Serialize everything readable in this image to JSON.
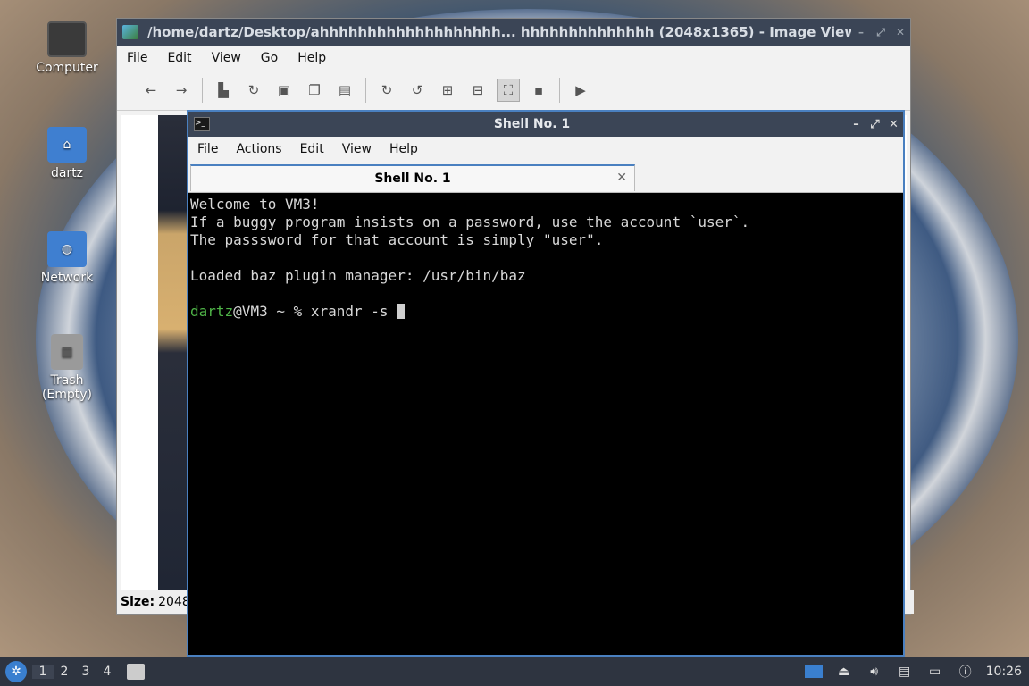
{
  "desktop": {
    "icons": [
      {
        "label": "Computer",
        "icon": "computer-icon"
      },
      {
        "label": "dartz",
        "icon": "home-folder-icon"
      },
      {
        "label": "Network",
        "icon": "network-icon"
      },
      {
        "label": "Trash (Empty)",
        "icon": "trash-icon"
      }
    ]
  },
  "image_viewer": {
    "title": "/home/dartz/Desktop/ahhhhhhhhhhhhhhhhhhh... hhhhhhhhhhhhhh (2048x1365) - Image Viewer",
    "menu": [
      "File",
      "Edit",
      "View",
      "Go",
      "Help"
    ],
    "status_label": "Size:",
    "status_value": "2048"
  },
  "shell": {
    "title": "Shell No. 1",
    "menu": [
      "File",
      "Actions",
      "Edit",
      "View",
      "Help"
    ],
    "tab_label": "Shell No. 1",
    "lines": [
      "Welcome to VM3!",
      "If a buggy program insists on a password, use the account `user`.",
      "The passsword for that account is simply \"user\".",
      "",
      "Loaded baz plugin manager: /usr/bin/baz",
      ""
    ],
    "prompt_user": "dartz",
    "prompt_rest": "@VM3 ~ % xrandr -s "
  },
  "taskbar": {
    "workspaces": [
      "1",
      "2",
      "3",
      "4"
    ],
    "active_workspace": "1",
    "clock": "10:26"
  }
}
